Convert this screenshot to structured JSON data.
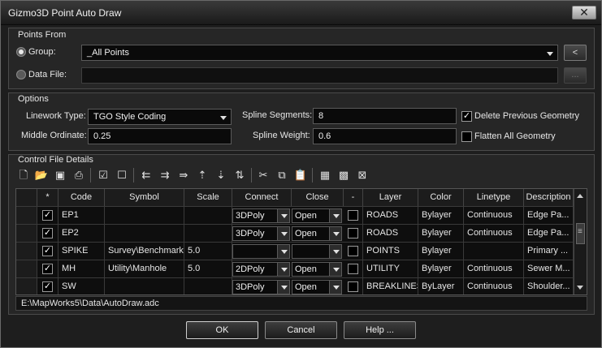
{
  "window": {
    "title": "Gizmo3D Point Auto Draw",
    "close_glyph": "✕"
  },
  "points_from": {
    "label": "Points From",
    "group_label": "Group:",
    "group_value": "_All Points",
    "group_selected": true,
    "pick_button": "<",
    "datafile_label": "Data File:",
    "datafile_value": "",
    "browse_button": "..."
  },
  "options": {
    "label": "Options",
    "linework_type_label": "Linework Type:",
    "linework_type_value": "TGO Style Coding",
    "middle_ordinate_label": "Middle Ordinate:",
    "middle_ordinate_value": "0.25",
    "spline_segments_label": "Spline Segments:",
    "spline_segments_value": "8",
    "spline_weight_label": "Spline Weight:",
    "spline_weight_value": "0.6",
    "delete_previous_label": "Delete Previous Geometry",
    "delete_previous_checked": true,
    "flatten_all_label": "Flatten All Geometry",
    "flatten_all_checked": false
  },
  "control_file": {
    "label": "Control File Details",
    "toolbar_icons": [
      "new-file-icon",
      "open-folder-icon",
      "save-icon",
      "print-icon",
      "check-all-icon",
      "uncheck-all-icon",
      "insert-row-icon",
      "delete-row-icon",
      "move-row-icon",
      "move-up-icon",
      "move-down-icon",
      "sort-az-icon",
      "cut-icon",
      "copy-icon",
      "paste-icon",
      "grid-view-icon",
      "grid-edit-icon",
      "grid-clear-icon"
    ],
    "columns": [
      "*",
      "Code",
      "Symbol",
      "Scale",
      "Connect",
      "Close",
      "-",
      "Layer",
      "Color",
      "Linetype",
      "Description"
    ],
    "rows": [
      {
        "checked": true,
        "code": "EP1",
        "symbol": "",
        "scale": "",
        "connect": "3DPoly",
        "close": "Open",
        "flag": false,
        "layer": "ROADS",
        "color": "Bylayer",
        "linetype": "Continuous",
        "description": "Edge Pa..."
      },
      {
        "checked": true,
        "code": "EP2",
        "symbol": "",
        "scale": "",
        "connect": "3DPoly",
        "close": "Open",
        "flag": false,
        "layer": "ROADS",
        "color": "Bylayer",
        "linetype": "Continuous",
        "description": "Edge Pa..."
      },
      {
        "checked": true,
        "code": "SPIKE",
        "symbol": "Survey\\Benchmark",
        "scale": "5.0",
        "connect": "",
        "close": "",
        "flag": false,
        "layer": "POINTS",
        "color": "Bylayer",
        "linetype": "",
        "description": "Primary ..."
      },
      {
        "checked": true,
        "code": "MH",
        "symbol": "Utility\\Manhole",
        "scale": "5.0",
        "connect": "2DPoly",
        "close": "Open",
        "flag": false,
        "layer": "UTILITY",
        "color": "Bylayer",
        "linetype": "Continuous",
        "description": "Sewer M..."
      },
      {
        "checked": true,
        "code": "SW",
        "symbol": "",
        "scale": "",
        "connect": "3DPoly",
        "close": "Open",
        "flag": false,
        "layer": "BREAKLINES",
        "color": "ByLayer",
        "linetype": "Continuous",
        "description": "Shoulder..."
      }
    ],
    "file_path": "E:\\MapWorks5\\Data\\AutoDraw.adc"
  },
  "buttons": {
    "ok": "OK",
    "cancel": "Cancel",
    "help": "Help ..."
  }
}
